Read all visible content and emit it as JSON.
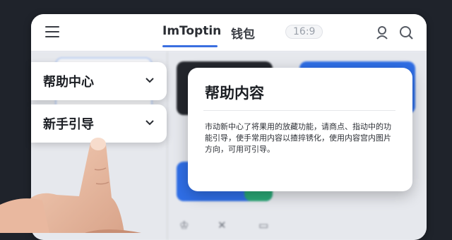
{
  "topbar": {
    "tab_app": "ImToptin",
    "tab_wallet": "钱包",
    "ratio": "16:9"
  },
  "dropdowns": [
    {
      "label": "帮助中心"
    },
    {
      "label": "新手引导"
    }
  ],
  "modal": {
    "title": "帮助内容",
    "body": "市动新中心了将果用的放藏功能，请商点、指动中的功能引导，使手常用内容以揸捽锈化，使用内容宫内图片方向，可用可引导。"
  },
  "colors": {
    "accent": "#3b6fe0",
    "frame_bg": "#1f232b"
  }
}
